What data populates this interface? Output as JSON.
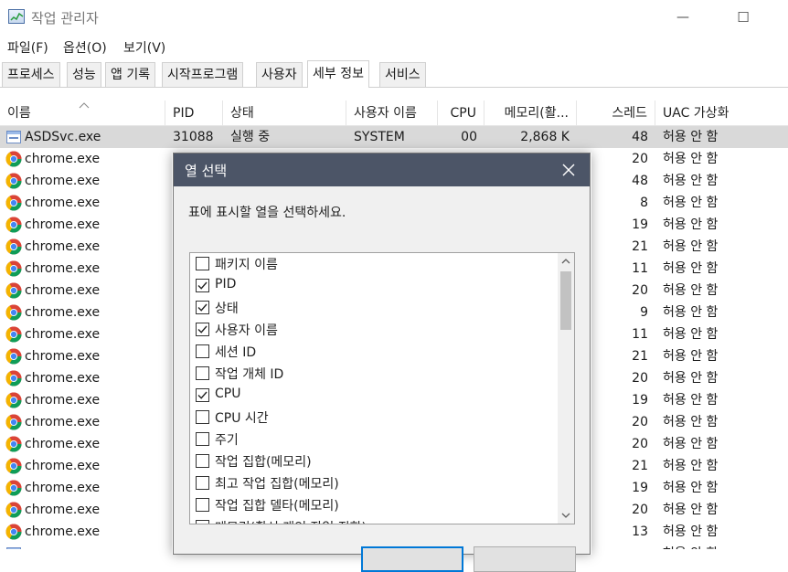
{
  "window": {
    "title": "작업 관리자",
    "minimize_glyph": "—",
    "maximize_glyph": "☐"
  },
  "menu": [
    "파일(F)",
    "옵션(O)",
    "보기(V)"
  ],
  "tabs": [
    "프로세스",
    "성능",
    "앱 기록",
    "시작프로그램",
    "사용자",
    "세부 정보",
    "서비스"
  ],
  "active_tab_index": 5,
  "table": {
    "columns": [
      "이름",
      "PID",
      "상태",
      "사용자 이름",
      "CPU",
      "메모리(활...",
      "스레드",
      "UAC 가상화"
    ],
    "sorted_column": "이름",
    "rows": [
      {
        "name": "ASDSvc.exe",
        "icon": "asdsvc-app-icon",
        "pid": "31088",
        "status": "실행 중",
        "user": "SYSTEM",
        "cpu": "00",
        "memory": "2,868 K",
        "threads": "48",
        "uac": "허용 안 함",
        "selected": true
      },
      {
        "name": "chrome.exe",
        "icon": "chrome-icon",
        "threads": "20",
        "uac": "허용 안 함"
      },
      {
        "name": "chrome.exe",
        "icon": "chrome-icon",
        "threads": "48",
        "uac": "허용 안 함"
      },
      {
        "name": "chrome.exe",
        "icon": "chrome-icon",
        "threads": "8",
        "uac": "허용 안 함"
      },
      {
        "name": "chrome.exe",
        "icon": "chrome-icon",
        "threads": "19",
        "uac": "허용 안 함"
      },
      {
        "name": "chrome.exe",
        "icon": "chrome-icon",
        "threads": "21",
        "uac": "허용 안 함"
      },
      {
        "name": "chrome.exe",
        "icon": "chrome-icon",
        "threads": "11",
        "uac": "허용 안 함"
      },
      {
        "name": "chrome.exe",
        "icon": "chrome-icon",
        "threads": "20",
        "uac": "허용 안 함"
      },
      {
        "name": "chrome.exe",
        "icon": "chrome-icon",
        "threads": "9",
        "uac": "허용 안 함"
      },
      {
        "name": "chrome.exe",
        "icon": "chrome-icon",
        "threads": "11",
        "uac": "허용 안 함"
      },
      {
        "name": "chrome.exe",
        "icon": "chrome-icon",
        "threads": "21",
        "uac": "허용 안 함"
      },
      {
        "name": "chrome.exe",
        "icon": "chrome-icon",
        "threads": "20",
        "uac": "허용 안 함"
      },
      {
        "name": "chrome.exe",
        "icon": "chrome-icon",
        "threads": "19",
        "uac": "허용 안 함"
      },
      {
        "name": "chrome.exe",
        "icon": "chrome-icon",
        "threads": "20",
        "uac": "허용 안 함"
      },
      {
        "name": "chrome.exe",
        "icon": "chrome-icon",
        "threads": "20",
        "uac": "허용 안 함"
      },
      {
        "name": "chrome.exe",
        "icon": "chrome-icon",
        "threads": "21",
        "uac": "허용 안 함"
      },
      {
        "name": "chrome.exe",
        "icon": "chrome-icon",
        "threads": "19",
        "uac": "허용 안 함"
      },
      {
        "name": "chrome.exe",
        "icon": "chrome-icon",
        "threads": "20",
        "uac": "허용 안 함"
      },
      {
        "name": "chrome.exe",
        "icon": "chrome-icon",
        "threads": "13",
        "uac": "허용 안 함"
      },
      {
        "name": "",
        "icon": "app-icon",
        "threads": "",
        "uac": "허용 안 함"
      }
    ]
  },
  "dialog": {
    "title": "열 선택",
    "description": "표에 표시할 열을 선택하세요.",
    "options": [
      {
        "label": "패키지 이름",
        "checked": false
      },
      {
        "label": "PID",
        "checked": true
      },
      {
        "label": "상태",
        "checked": true
      },
      {
        "label": "사용자 이름",
        "checked": true
      },
      {
        "label": "세션 ID",
        "checked": false
      },
      {
        "label": "작업 개체 ID",
        "checked": false
      },
      {
        "label": "CPU",
        "checked": true
      },
      {
        "label": "CPU 시간",
        "checked": false
      },
      {
        "label": "주기",
        "checked": false
      },
      {
        "label": "작업 집합(메모리)",
        "checked": false
      },
      {
        "label": "최고 작업 집합(메모리)",
        "checked": false
      },
      {
        "label": "작업 집합 델타(메모리)",
        "checked": false
      },
      {
        "label": "메모리(활성 개인 작업 집합)",
        "checked": false
      }
    ]
  },
  "colors": {
    "dialog_title_bg": "#4c5567",
    "selected_row": "#d9d9d9",
    "primary_button_border": "#0078d7"
  }
}
